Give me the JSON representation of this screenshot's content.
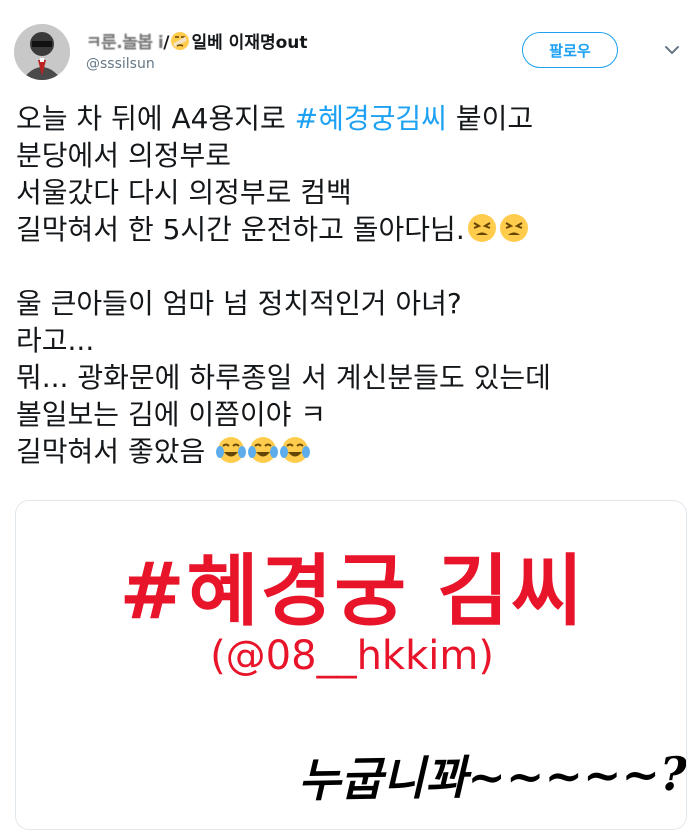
{
  "header": {
    "display_name_blurred": "ㅋ룬.놀봅 i",
    "display_name_rest": "일베 이재명out",
    "handle": "@sssilsun",
    "follow_label": "팔로우",
    "icons": [
      "avatar",
      "bandage-emoji-icon",
      "chevron-down-icon"
    ]
  },
  "tweet": {
    "line1_before": "오늘 차 뒤에 A4용지로 ",
    "line1_hashtag": "#혜경궁김씨",
    "line1_after": " 붙이고",
    "line2": "분당에서 의정부로",
    "line3": "서울갔다 다시 의정부로 컴백",
    "line4": "길막혀서 한 5시간 운전하고 돌아다님.",
    "line5": "울 큰아들이 엄마 넘 정치적인거 아녀?",
    "line6": "라고...",
    "line7": "뭐...  광화문에 하루종일 서 계신분들도 있는데",
    "line8": "볼일보는 김에 이쯤이야 ㅋ",
    "line9": "길막혀서 좋았음",
    "emoji": [
      "tired-face-icon",
      "tired-face-icon",
      "tears-of-joy-icon",
      "tears-of-joy-icon",
      "tears-of-joy-icon"
    ]
  },
  "card": {
    "title": "#혜경궁 김씨",
    "subtitle": "(@08__hkkim)",
    "handwritten": "누굽니꽈~~~~~?",
    "accent_color": "#e8142a"
  },
  "colors": {
    "link": "#1da1f2",
    "text": "#14171a",
    "muted": "#657786"
  }
}
